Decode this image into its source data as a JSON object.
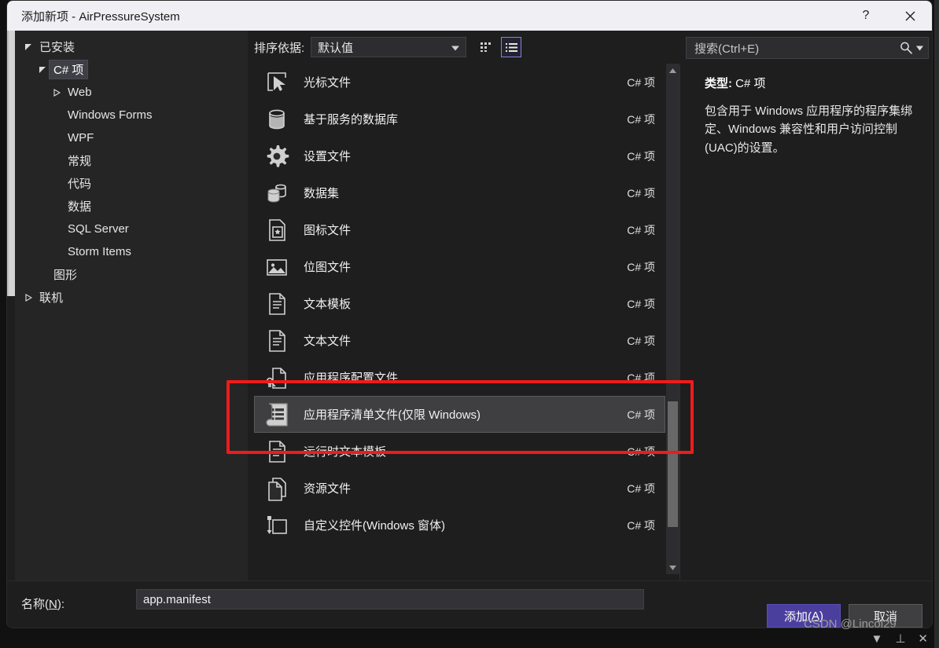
{
  "window": {
    "title": "添加新项 - AirPressureSystem",
    "help_label": "?",
    "close_label": "✕"
  },
  "sidebar": {
    "items": [
      {
        "label": "已安装",
        "level": 0,
        "arrow": "down",
        "selected": false
      },
      {
        "label": "C# 项",
        "level": 1,
        "arrow": "down",
        "selected": true
      },
      {
        "label": "Web",
        "level": 2,
        "arrow": "right",
        "selected": false
      },
      {
        "label": "Windows Forms",
        "level": 2,
        "arrow": "none",
        "selected": false
      },
      {
        "label": "WPF",
        "level": 2,
        "arrow": "none",
        "selected": false
      },
      {
        "label": "常规",
        "level": 2,
        "arrow": "none",
        "selected": false
      },
      {
        "label": "代码",
        "level": 2,
        "arrow": "none",
        "selected": false
      },
      {
        "label": "数据",
        "level": 2,
        "arrow": "none",
        "selected": false
      },
      {
        "label": "SQL Server",
        "level": 2,
        "arrow": "none",
        "selected": false
      },
      {
        "label": "Storm Items",
        "level": 2,
        "arrow": "none",
        "selected": false
      },
      {
        "label": "图形",
        "level": 1,
        "arrow": "none",
        "selected": false
      },
      {
        "label": "联机",
        "level": 0,
        "arrow": "right",
        "selected": false
      }
    ]
  },
  "toolbar": {
    "sort_label": "排序依据:",
    "sort_value": "默认值",
    "grid_view_icon": "grid-view-icon",
    "list_view_icon": "list-view-icon",
    "active_view": "list"
  },
  "search": {
    "placeholder": "搜索(Ctrl+E)",
    "search_icon": "search-icon",
    "dropdown_icon": "chevron-down-icon"
  },
  "details": {
    "type_label": "类型:",
    "type_value": "C# 项",
    "description": "包含用于 Windows 应用程序的程序集绑定、Windows 兼容性和用户访问控制(UAC)的设置。"
  },
  "items": [
    {
      "name": "光标文件",
      "kind": "C# 项",
      "icon": "cursor-file-icon",
      "selected": false
    },
    {
      "name": "基于服务的数据库",
      "kind": "C# 项",
      "icon": "database-icon",
      "selected": false
    },
    {
      "name": "设置文件",
      "kind": "C# 项",
      "icon": "gear-icon",
      "selected": false
    },
    {
      "name": "数据集",
      "kind": "C# 项",
      "icon": "dataset-icon",
      "selected": false
    },
    {
      "name": "图标文件",
      "kind": "C# 项",
      "icon": "icon-file-icon",
      "selected": false
    },
    {
      "name": "位图文件",
      "kind": "C# 项",
      "icon": "bitmap-file-icon",
      "selected": false
    },
    {
      "name": "文本模板",
      "kind": "C# 项",
      "icon": "text-template-icon",
      "selected": false
    },
    {
      "name": "文本文件",
      "kind": "C# 项",
      "icon": "text-file-icon",
      "selected": false
    },
    {
      "name": "应用程序配置文件",
      "kind": "C# 项",
      "icon": "config-file-icon",
      "selected": false
    },
    {
      "name": "应用程序清单文件(仅限 Windows)",
      "kind": "C# 项",
      "icon": "manifest-file-icon",
      "selected": true
    },
    {
      "name": "运行时文本模板",
      "kind": "C# 项",
      "icon": "runtime-text-template-icon",
      "selected": false
    },
    {
      "name": "资源文件",
      "kind": "C# 项",
      "icon": "resource-file-icon",
      "selected": false
    },
    {
      "name": "自定义控件(Windows 窗体)",
      "kind": "C# 项",
      "icon": "user-control-icon",
      "selected": false
    }
  ],
  "name_field": {
    "label": "名称(N):",
    "value": "app.manifest"
  },
  "footer": {
    "add_label": "添加(A)",
    "cancel_label": "取消"
  },
  "annotation": {
    "color": "#ef1b1b"
  },
  "watermark": {
    "text": "CSDN @Lincol29"
  },
  "colors": {
    "accent": "#4b3f9e",
    "dialog_bg": "#1e1e1e",
    "tree_bg": "#252526",
    "titlebar_bg": "#f0f0f4",
    "selection_bg": "#3f3f41",
    "annotation_red": "#ef1b1b"
  }
}
